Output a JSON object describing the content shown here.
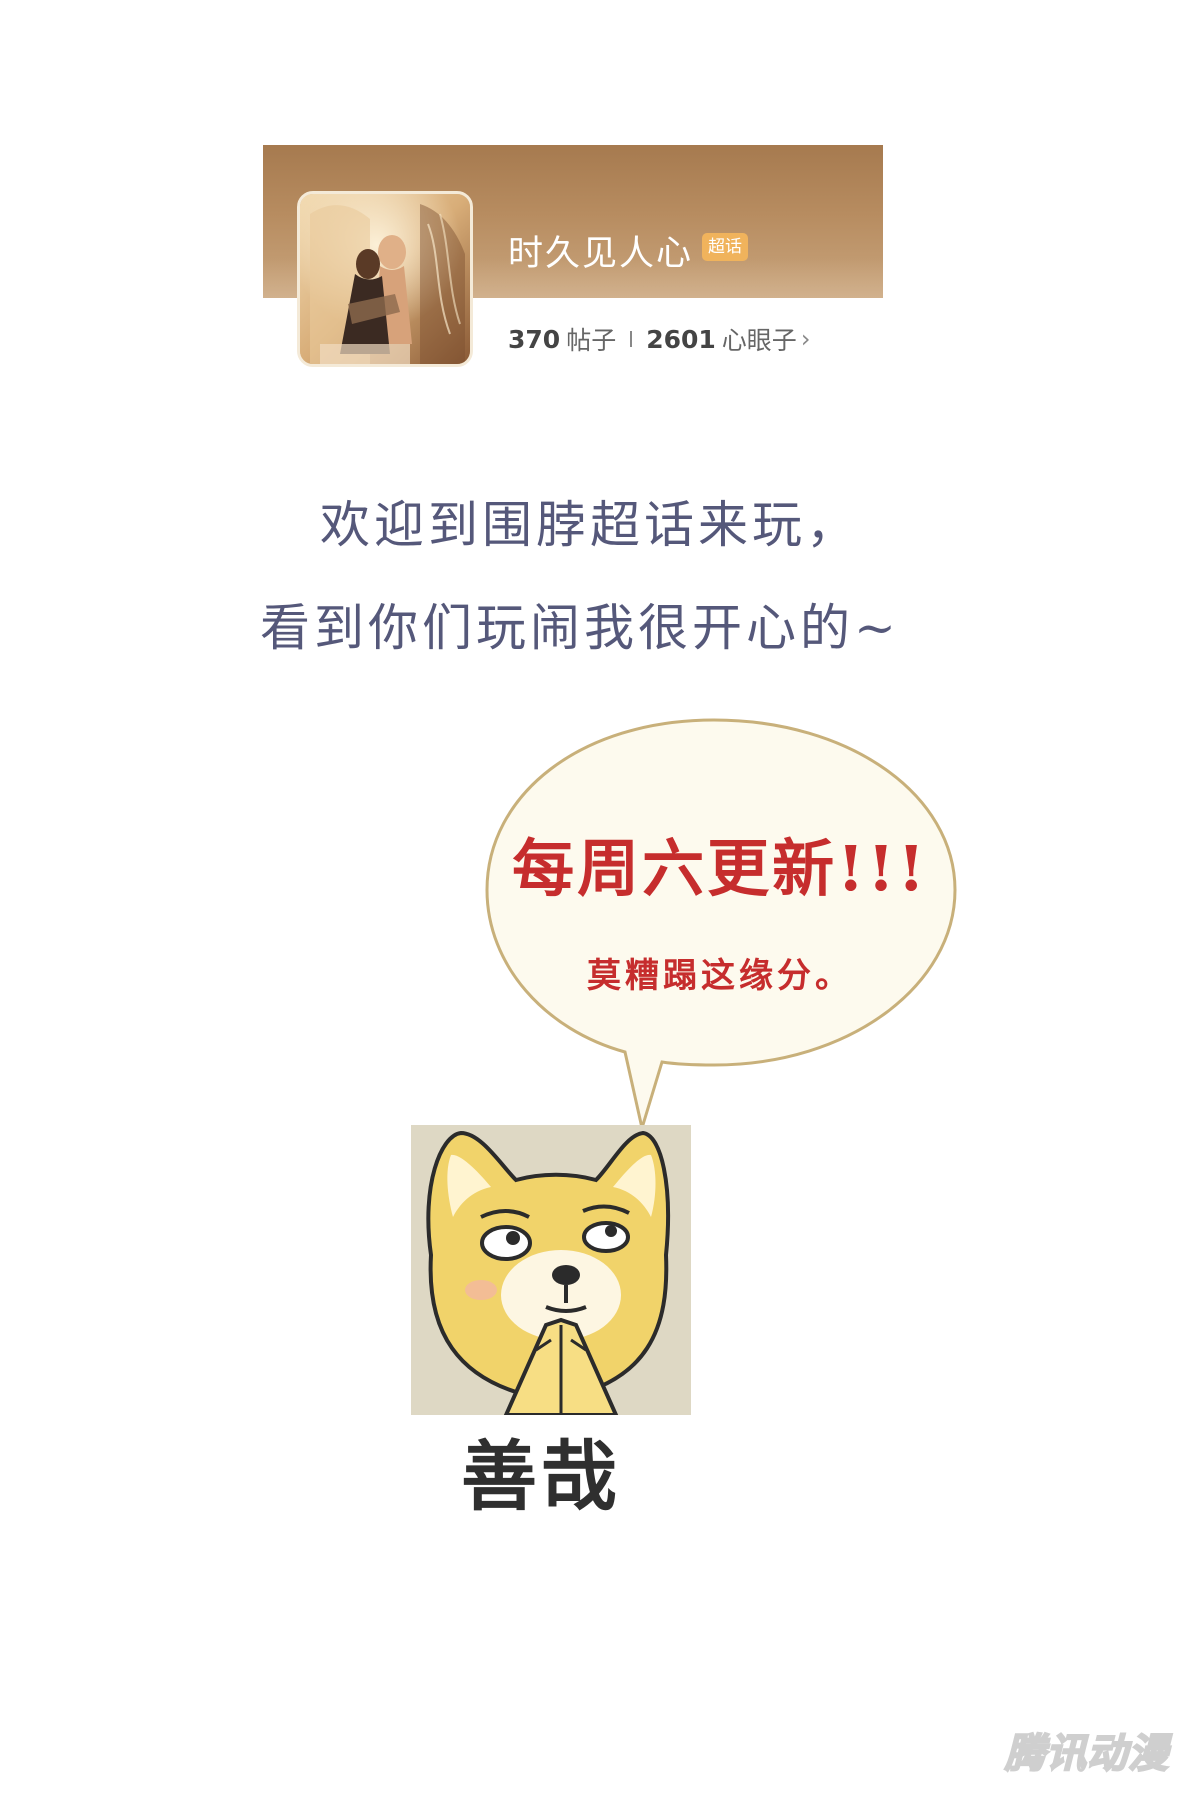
{
  "topic_card": {
    "name": "时久见人心",
    "badge": "超话",
    "posts_count": "370",
    "posts_label": "帖子",
    "members_count": "2601",
    "members_label": "心眼子",
    "chevron": "›",
    "banner_color": "#b08458",
    "badge_color": "#f0b35c"
  },
  "welcome": {
    "line1": "欢迎到围脖超话来玩，",
    "line2": "看到你们玩闹我很开心的~",
    "color": "#55587a"
  },
  "bubble": {
    "title": "每周六更新!!!",
    "subtitle": "莫糟蹋这缘分。",
    "text_color": "#c62d2d",
    "fill_color": "#fdfaee",
    "border_color": "#c8b07a"
  },
  "meme": {
    "caption": "善哉",
    "icon": "doge-praying-icon"
  },
  "watermark": {
    "text": "腾讯动漫",
    "icon": "tencent-comic-logo"
  }
}
